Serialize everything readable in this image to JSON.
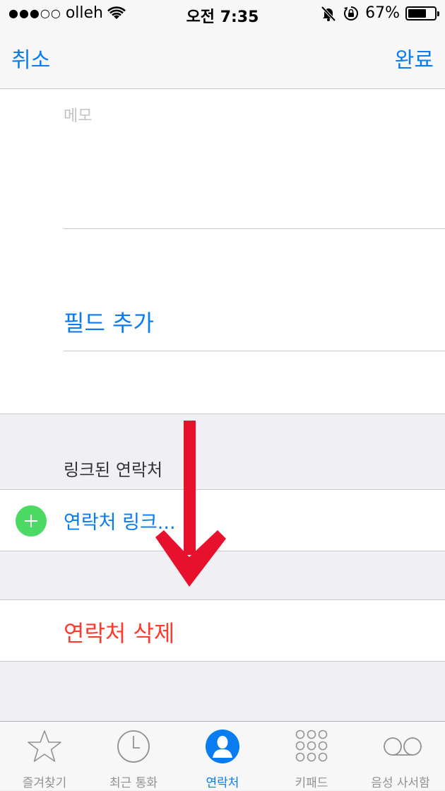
{
  "status_bar": {
    "carrier": "olleh",
    "time": "오전 7:35",
    "battery": "67%",
    "battery_level": 0.67,
    "icons": [
      "signal-dots",
      "wifi-icon",
      "silent-bell-icon",
      "rotation-lock-icon",
      "battery-icon"
    ]
  },
  "nav": {
    "cancel_label": "취소",
    "done_label": "완료"
  },
  "form": {
    "memo_placeholder": "메모",
    "add_field_label": "필드 추가"
  },
  "linked": {
    "header": "링크된 연락처",
    "link_label": "연락처 링크..."
  },
  "delete": {
    "label": "연락처 삭제"
  },
  "tabs": [
    {
      "label": "즐겨찾기",
      "icon": "star-icon",
      "active": false
    },
    {
      "label": "최근 통화",
      "icon": "clock-icon",
      "active": false
    },
    {
      "label": "연락처",
      "icon": "contacts-icon",
      "active": true
    },
    {
      "label": "키패드",
      "icon": "keypad-icon",
      "active": false
    },
    {
      "label": "음성 사서함",
      "icon": "voicemail-icon",
      "active": false
    }
  ],
  "colors": {
    "tint": "#0a7cf2",
    "destructive": "#ff3b30",
    "add_green": "#4cd964",
    "annotation_arrow": "#e8112d"
  }
}
